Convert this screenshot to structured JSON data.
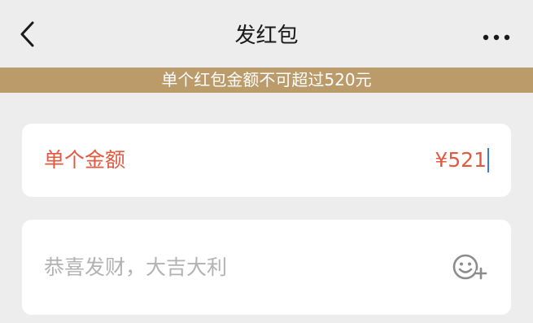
{
  "nav": {
    "title": "发红包",
    "back_icon": "chevron-left-icon",
    "more_icon": "more-horizontal-icon"
  },
  "notice": {
    "text": "单个红包金额不可超过520元",
    "color": "#bc9b6a"
  },
  "amount": {
    "label": "单个金额",
    "value": "¥521",
    "color": "#e2593f"
  },
  "greeting": {
    "placeholder": "恭喜发财，大吉大利",
    "emoji_icon": "emoji-add-icon"
  }
}
